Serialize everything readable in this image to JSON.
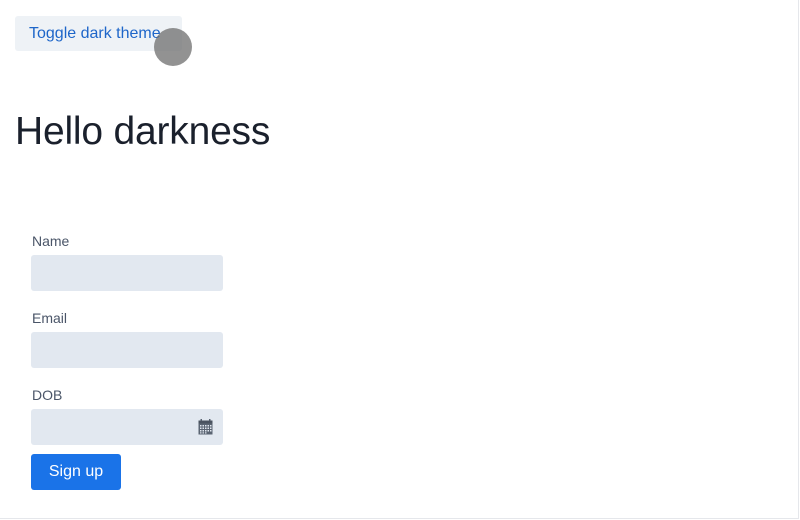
{
  "header": {
    "toggle_label": "Toggle dark theme"
  },
  "main": {
    "title": "Hello darkness"
  },
  "form": {
    "name_label": "Name",
    "name_value": "",
    "email_label": "Email",
    "email_value": "",
    "dob_label": "DOB",
    "dob_value": "",
    "dob_icon": "calendar-icon",
    "submit_label": "Sign up"
  },
  "colors": {
    "accent": "#1a73e8",
    "link": "#1e66c9",
    "input_bg": "#e2e8f0",
    "toggle_bg": "#eef2f6"
  }
}
